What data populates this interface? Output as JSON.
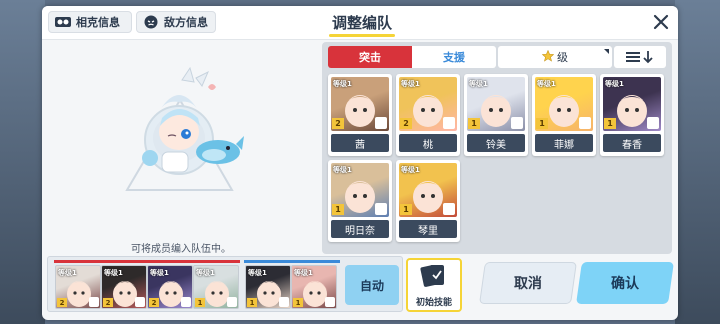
{
  "header": {
    "title": "调整编队",
    "pill_1": "相克信息",
    "pill_2": "敌方信息"
  },
  "preview": {
    "hint": "可将成员编入队伍中。"
  },
  "filters": {
    "tab_striker": "突击",
    "tab_special": "支援",
    "sort_label": "级"
  },
  "roster": [
    {
      "name": "茜",
      "level": "等级1",
      "star": "2",
      "colors": [
        "#c9a07a",
        "#6c4a3a"
      ]
    },
    {
      "name": "桃",
      "level": "等级1",
      "star": "2",
      "colors": [
        "#f0c35a",
        "#ffb6a8"
      ]
    },
    {
      "name": "铃美",
      "level": "等级1",
      "star": "1",
      "colors": [
        "#dfe3ec",
        "#8a8fa8"
      ]
    },
    {
      "name": "菲娜",
      "level": "等级1",
      "star": "1",
      "colors": [
        "#ffd34d",
        "#f6b36b"
      ]
    },
    {
      "name": "春香",
      "level": "等级1",
      "star": "1",
      "colors": [
        "#3d3350",
        "#a08ac8"
      ]
    },
    {
      "name": "明日奈",
      "level": "等级1",
      "star": "1",
      "colors": [
        "#d9bf9a",
        "#5e7fb3"
      ]
    },
    {
      "name": "琴里",
      "level": "等级1",
      "star": "1",
      "colors": [
        "#f2c24e",
        "#c24a3a"
      ]
    }
  ],
  "team": [
    {
      "level": "等级1",
      "star": "2",
      "colors": [
        "#e3dcd6",
        "#7b4a4a"
      ]
    },
    {
      "level": "等级1",
      "star": "2",
      "colors": [
        "#2e2a2a",
        "#b65b5b"
      ]
    },
    {
      "level": "等级1",
      "star": "2",
      "colors": [
        "#3a3560",
        "#9c8ad0"
      ]
    },
    {
      "level": "等级1",
      "star": "1",
      "colors": [
        "#d8dfe0",
        "#93b3a0"
      ]
    },
    {
      "level": "等级1",
      "star": "1",
      "colors": [
        "#2c2c34",
        "#e9d5c7"
      ]
    },
    {
      "level": "等级1",
      "star": "1",
      "colors": [
        "#e8b6b0",
        "#7c4b4b"
      ]
    }
  ],
  "buttons": {
    "auto": "自动",
    "initial_skill": "初始技能",
    "cancel": "取消",
    "confirm": "确认"
  },
  "colors": {
    "striker_red": "#d8333b",
    "special_blue": "#3a8ad9",
    "accent_yellow": "#f5d437",
    "confirm_cyan": "#7ed3f7"
  }
}
